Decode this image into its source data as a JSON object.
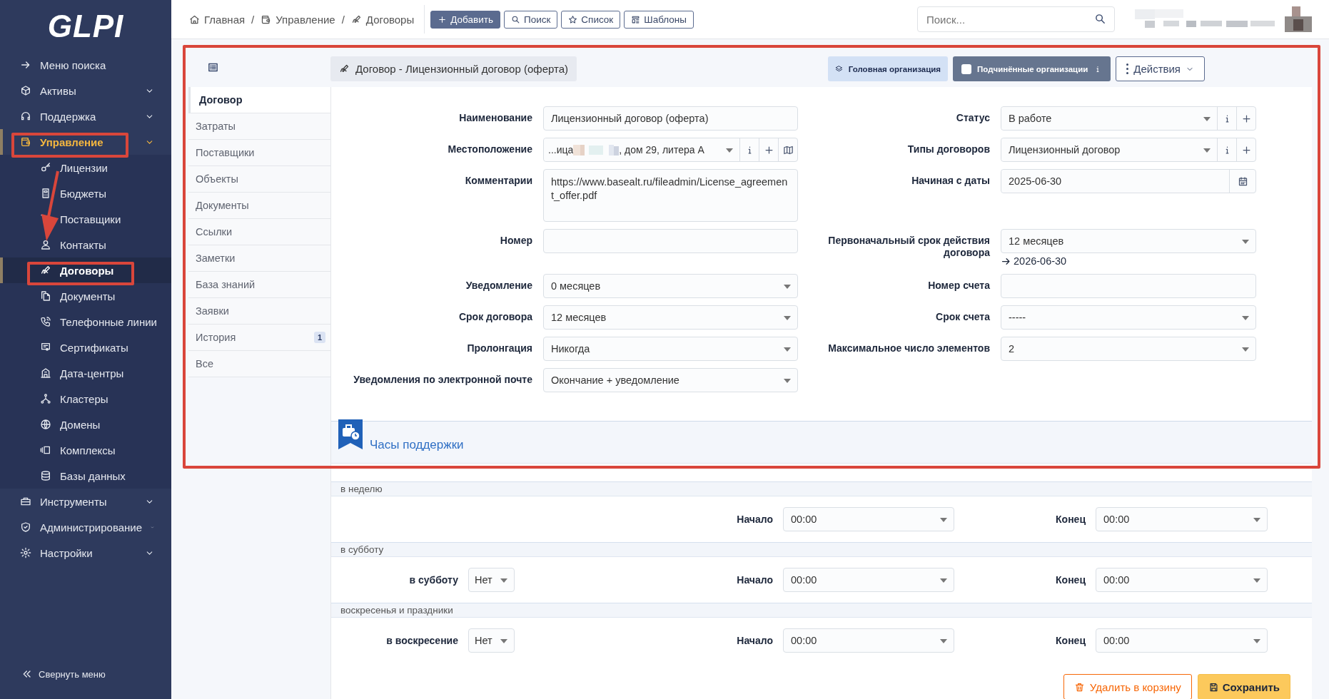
{
  "sidebar": {
    "logo": "GLPI",
    "items": [
      {
        "label": "Меню поиска",
        "selected": false,
        "expandable": false
      },
      {
        "label": "Активы",
        "selected": false,
        "expandable": true
      },
      {
        "label": "Поддержка",
        "selected": false,
        "expandable": true
      },
      {
        "label": "Управление",
        "selected": true,
        "expandable": true,
        "children": [
          {
            "label": "Лицензии",
            "selected": false
          },
          {
            "label": "Бюджеты",
            "selected": false
          },
          {
            "label": "Поставщики",
            "selected": false
          },
          {
            "label": "Контакты",
            "selected": false
          },
          {
            "label": "Договоры",
            "selected": true
          },
          {
            "label": "Документы",
            "selected": false
          },
          {
            "label": "Телефонные линии",
            "selected": false
          },
          {
            "label": "Сертификаты",
            "selected": false
          },
          {
            "label": "Дата-центры",
            "selected": false
          },
          {
            "label": "Кластеры",
            "selected": false
          },
          {
            "label": "Домены",
            "selected": false
          },
          {
            "label": "Комплексы",
            "selected": false
          },
          {
            "label": "Базы данных",
            "selected": false
          }
        ]
      },
      {
        "label": "Инструменты",
        "selected": false,
        "expandable": true
      },
      {
        "label": "Администрирование",
        "selected": false,
        "expandable": true
      },
      {
        "label": "Настройки",
        "selected": false,
        "expandable": true
      }
    ],
    "collapse_label": "Свернуть меню"
  },
  "breadcrumb": [
    {
      "kind": "link",
      "label": "Главная"
    },
    {
      "kind": "separator",
      "label": "/"
    },
    {
      "kind": "link",
      "label": "Управление"
    },
    {
      "kind": "separator",
      "label": "/"
    },
    {
      "kind": "link",
      "label": "Договоры"
    }
  ],
  "toolbar": [
    {
      "label": "Добавить",
      "primary": true
    },
    {
      "label": "Поиск",
      "primary": false
    },
    {
      "label": "Список",
      "primary": false
    },
    {
      "label": "Шаблоны",
      "primary": false
    }
  ],
  "search": {
    "placeholder": "Поиск..."
  },
  "header": {
    "title": "Договор - Лицензионный договор (оферта)",
    "entity": "Головная организация",
    "subentities": {
      "label": "Подчинённые организации",
      "checked": false
    },
    "actions": "Действия"
  },
  "tabs": [
    {
      "label": "Договор",
      "selected": true
    },
    {
      "label": "Затраты",
      "selected": false
    },
    {
      "label": "Поставщики",
      "selected": false
    },
    {
      "label": "Объекты",
      "selected": false
    },
    {
      "label": "Документы",
      "selected": false
    },
    {
      "label": "Ссылки",
      "selected": false
    },
    {
      "label": "Заметки",
      "selected": false
    },
    {
      "label": "База знаний",
      "selected": false
    },
    {
      "label": "Заявки",
      "selected": false
    },
    {
      "label": "История",
      "selected": false,
      "badge": "1"
    },
    {
      "label": "Все",
      "selected": false
    }
  ],
  "form": {
    "left": [
      {
        "label": "Наименование",
        "kind": "text",
        "value": "Лицензионный договор (оферта)"
      },
      {
        "label": "Местоположение",
        "kind": "location",
        "value_start": "...ица",
        "value_end": ", дом 29, литера А"
      },
      {
        "label": "Комментарии",
        "kind": "textarea",
        "value": "https://www.basealt.ru/fileadmin/License_agreement_offer.pdf"
      },
      {
        "label": "Номер",
        "kind": "text"
      },
      {
        "label": "Уведомление",
        "kind": "select",
        "value": "0 месяцев"
      },
      {
        "label": "Срок договора",
        "kind": "select",
        "value": "12 месяцев"
      },
      {
        "label": "Пролонгация",
        "kind": "select",
        "value": "Никогда"
      },
      {
        "label": "Уведомления по электронной почте",
        "kind": "select",
        "value": "Окончание + уведомление"
      }
    ],
    "right": [
      {
        "label": "Статус",
        "kind": "select_add",
        "value": "В работе"
      },
      {
        "label": "Типы договоров",
        "kind": "select_add",
        "value": "Лицензионный договор"
      },
      {
        "label": "Начиная с даты",
        "kind": "date",
        "value": "2025-06-30"
      },
      {
        "label": "Первоначальный срок действия договора",
        "kind": "select",
        "value": "12 месяцев",
        "note": "2026-06-30"
      },
      {
        "label": "Номер счета",
        "kind": "text"
      },
      {
        "label": "Срок счета",
        "kind": "select",
        "value": "-----"
      },
      {
        "label": "Максимальное число элементов",
        "kind": "select",
        "value": "2"
      }
    ]
  },
  "support_hours": {
    "title": "Часы поддержки",
    "sections": [
      {
        "title": "в неделю",
        "start": {
          "label": "Начало",
          "value": "00:00"
        },
        "end": {
          "label": "Конец",
          "value": "00:00"
        }
      },
      {
        "title": "в субботу",
        "toggle": {
          "label": "в субботу",
          "value": "Нет"
        },
        "start": {
          "label": "Начало",
          "value": "00:00"
        },
        "end": {
          "label": "Конец",
          "value": "00:00"
        }
      },
      {
        "title": "воскресенья и праздники",
        "toggle": {
          "label": "в воскресение",
          "value": "Нет"
        },
        "start": {
          "label": "Начало",
          "value": "00:00"
        },
        "end": {
          "label": "Конец",
          "value": "00:00"
        }
      }
    ]
  },
  "buttons": {
    "delete": "Удалить в корзину",
    "save": "Сохранить"
  }
}
